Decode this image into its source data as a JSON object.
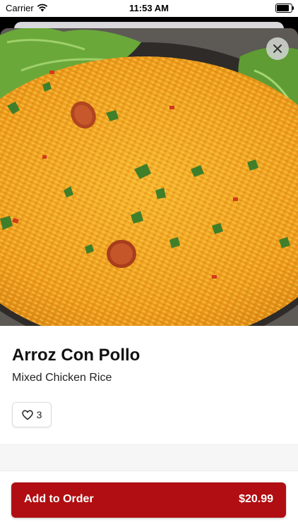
{
  "status_bar": {
    "carrier": "Carrier",
    "time": "11:53 AM",
    "battery_level": 0.92
  },
  "item": {
    "name": "Arroz Con Pollo",
    "description": "Mixed Chicken Rice",
    "favorites_count": "3",
    "image_icon": "food-photo"
  },
  "order": {
    "label": "Add to Order",
    "price": "$20.99"
  },
  "colors": {
    "accent": "#b00e12",
    "rice": "#f0a520",
    "lettuce": "#6aa83a"
  }
}
